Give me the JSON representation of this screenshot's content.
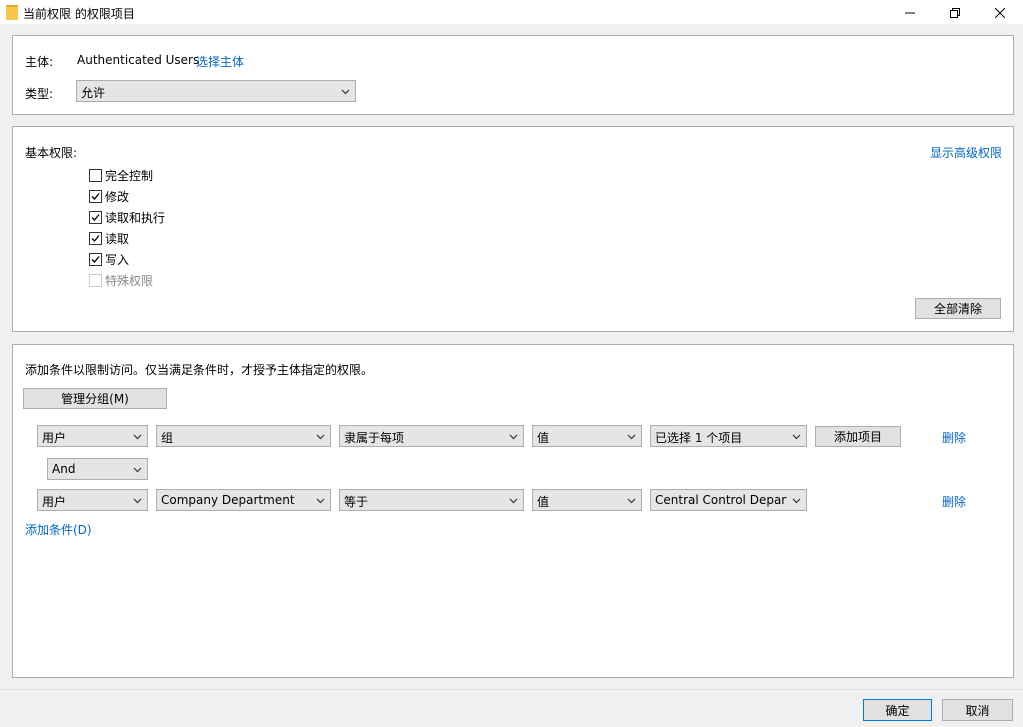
{
  "window": {
    "title": "当前权限 的权限项目"
  },
  "principal": {
    "label": "主体:",
    "value": "Authenticated Users",
    "select_link": "选择主体",
    "type_label": "类型:",
    "type_value": "允许"
  },
  "basic_permissions": {
    "label": "基本权限:",
    "show_advanced_link": "显示高级权限",
    "items": [
      {
        "label": "完全控制",
        "checked": false,
        "disabled": false
      },
      {
        "label": "修改",
        "checked": true,
        "disabled": false
      },
      {
        "label": "读取和执行",
        "checked": true,
        "disabled": false
      },
      {
        "label": "读取",
        "checked": true,
        "disabled": false
      },
      {
        "label": "写入",
        "checked": true,
        "disabled": false
      },
      {
        "label": "特殊权限",
        "checked": false,
        "disabled": true
      }
    ],
    "clear_all_button": "全部清除"
  },
  "conditions": {
    "description": "添加条件以限制访问。仅当满足条件时，才授予主体指定的权限。",
    "manage_groups_button": "管理分组(M)",
    "rows": [
      {
        "subject": "用户",
        "attribute": "组",
        "operator": "隶属于每项",
        "value_type": "值",
        "value": "已选择 1 个项目",
        "add_items_button": "添加项目",
        "remove_link": "删除"
      },
      {
        "subject": "用户",
        "attribute": "Company Department",
        "operator": "等于",
        "value_type": "值",
        "value": "Central Control Departmε",
        "remove_link": "删除"
      }
    ],
    "connector": "And",
    "add_condition_link": "添加条件(D)"
  },
  "footer": {
    "ok_button": "确定",
    "cancel_button": "取消"
  },
  "colors": {
    "link": "#0066cc",
    "default_button_border": "#0078d7",
    "folder_icon": "#f5c84c"
  }
}
